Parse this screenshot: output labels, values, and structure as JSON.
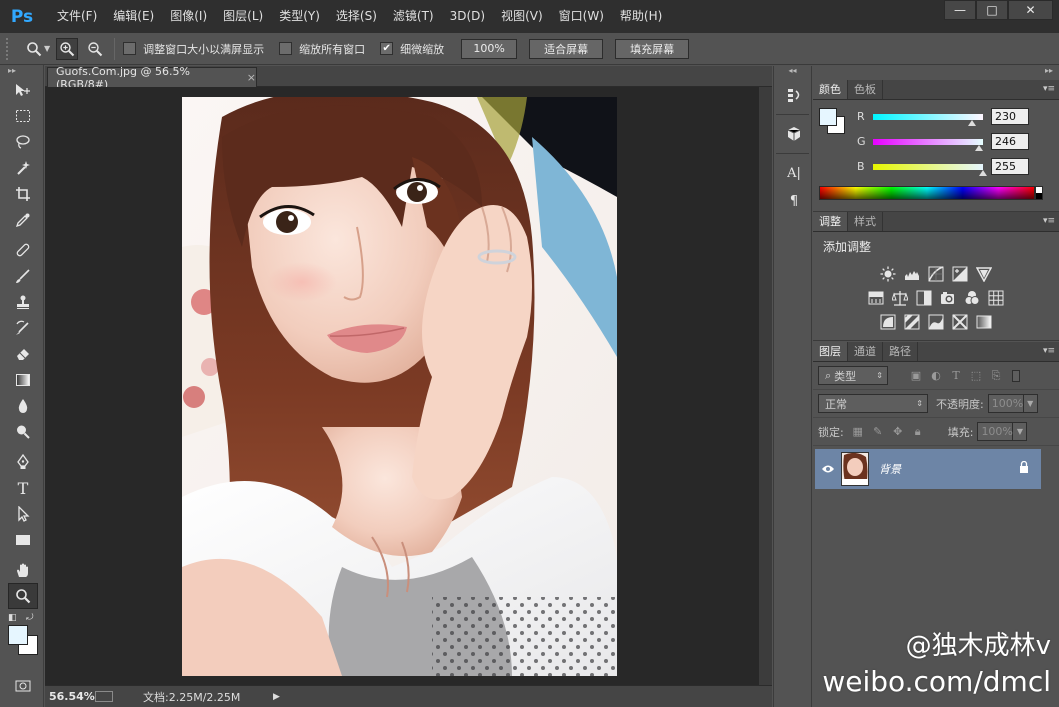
{
  "app": {
    "logo": "Ps",
    "menus": [
      "文件(F)",
      "编辑(E)",
      "图像(I)",
      "图层(L)",
      "类型(Y)",
      "选择(S)",
      "滤镜(T)",
      "3D(D)",
      "视图(V)",
      "窗口(W)",
      "帮助(H)"
    ],
    "window_controls": {
      "minimize": "—",
      "maximize": "□",
      "close": "✕"
    }
  },
  "options_bar": {
    "resize_windows": {
      "label": "调整窗口大小以满屏显示",
      "checked": false
    },
    "zoom_all": {
      "label": "缩放所有窗口",
      "checked": false
    },
    "scrubby_zoom": {
      "label": "细微缩放",
      "checked": true
    },
    "btn_100": "100%",
    "btn_fit": "适合屏幕",
    "btn_fill": "填充屏幕"
  },
  "document": {
    "tab_title": "Guofs.Com.jpg @ 56.5%(RGB/8#)",
    "tab_close": "×",
    "zoom": "56.54%",
    "doc_info": "文档:2.25M/2.25M"
  },
  "color_panel": {
    "tabs": [
      "颜色",
      "色板"
    ],
    "foreground_hex": "#e6f6ff",
    "background_hex": "#ffffff",
    "channels": [
      {
        "label": "R",
        "value": "230",
        "fraction": 0.902
      },
      {
        "label": "G",
        "value": "246",
        "fraction": 0.965
      },
      {
        "label": "B",
        "value": "255",
        "fraction": 1.0
      }
    ]
  },
  "adjustments_panel": {
    "tabs": [
      "调整",
      "样式"
    ],
    "title": "添加调整",
    "rows": [
      [
        "brightness-contrast-icon",
        "levels-icon",
        "curves-icon",
        "exposure-icon",
        "vibrance-icon"
      ],
      [
        "hue-saturation-icon",
        "color-balance-icon",
        "black-white-icon",
        "photo-filter-icon",
        "channel-mixer-icon",
        "color-lookup-icon"
      ],
      [
        "invert-icon",
        "posterize-icon",
        "threshold-icon",
        "selective-color-icon",
        "gradient-map-icon"
      ]
    ]
  },
  "layers_panel": {
    "tabs": [
      "图层",
      "通道",
      "路径"
    ],
    "filter_type": "类型",
    "blend_mode": "正常",
    "opacity_label": "不透明度:",
    "opacity_value": "100%",
    "lock_label": "锁定:",
    "fill_label": "填充:",
    "fill_value": "100%",
    "layers": [
      {
        "name": "背景",
        "visible": true,
        "locked": true
      }
    ]
  },
  "watermark": {
    "line1": "@独木成林v",
    "line2": "weibo.com/dmcl"
  },
  "colors": {
    "accent": "#31a8ff",
    "layer_selected": "#6d85a6"
  }
}
